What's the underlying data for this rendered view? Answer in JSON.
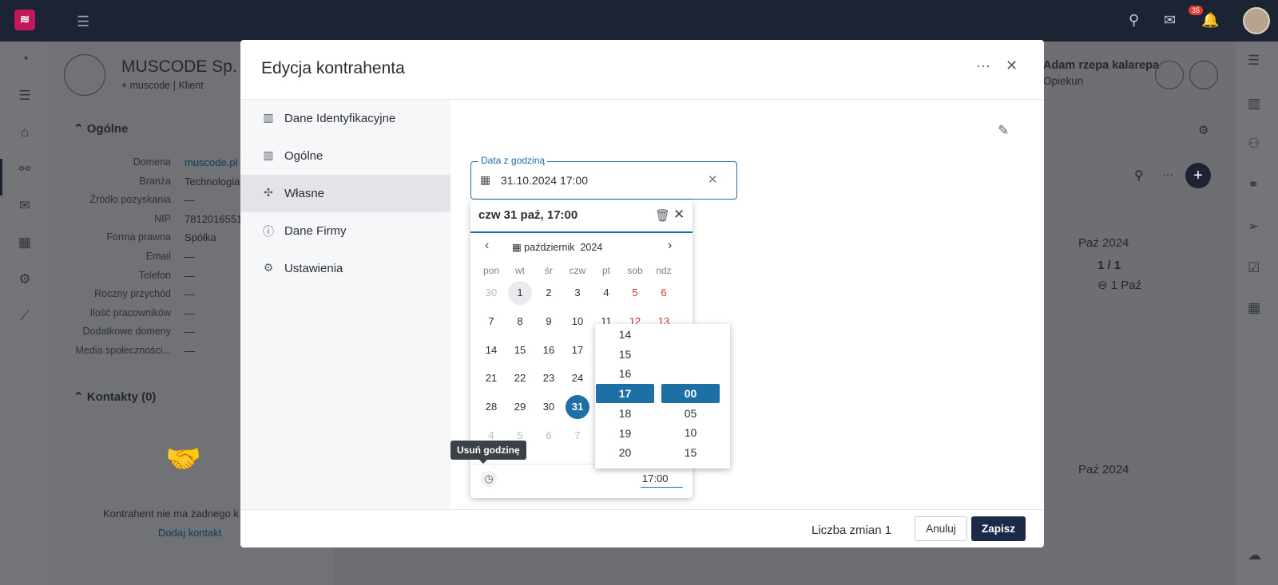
{
  "topbar": {
    "notif_count": "35"
  },
  "background": {
    "company_name": "MUSCODE Sp. z",
    "tag": "muscode",
    "tag_type": "Klient",
    "section_general": "Ogólne",
    "fields": [
      {
        "label": "Domena",
        "value": "muscode.pl"
      },
      {
        "label": "Branża",
        "value": "Technologia"
      },
      {
        "label": "Źródło pozyskania",
        "value": "—"
      },
      {
        "label": "NIP",
        "value": "7812016551"
      },
      {
        "label": "Forma prawna",
        "value": "Spółka"
      },
      {
        "label": "Email",
        "value": "—"
      },
      {
        "label": "Telefon",
        "value": "—"
      },
      {
        "label": "Roczny przychód",
        "value": "—"
      },
      {
        "label": "Ilość pracowników",
        "value": "—"
      },
      {
        "label": "Dodatkowe domeny",
        "value": "—"
      },
      {
        "label": "Media społeczności...",
        "value": "—"
      }
    ],
    "section_contacts": "Kontakty (0)",
    "contacts_empty": "Kontrahent nie ma żadnego k",
    "add_contact": "Dodaj kontakt",
    "owner_name": "Adam rzepa kalarepa",
    "owner_role": "Opiekun",
    "timeline_month_1": "Paź 2024",
    "timeline_count": "1 / 1",
    "timeline_item": "1 Paź",
    "timeline_month_2": "Paź 2024"
  },
  "modal": {
    "title": "Edycja kontrahenta",
    "menu": [
      {
        "label": "Dane Identyfikacyjne"
      },
      {
        "label": "Ogólne"
      },
      {
        "label": "Własne"
      },
      {
        "label": "Dane Firmy"
      },
      {
        "label": "Ustawienia"
      }
    ],
    "changes_label": "Liczba zmian 1",
    "cancel_label": "Anuluj",
    "save_label": "Zapisz"
  },
  "datefield": {
    "label": "Data z godziną",
    "value": "31.10.2024 17:00"
  },
  "calendar": {
    "header": "czw 31 paź, 17:00",
    "month": "październik",
    "year": "2024",
    "weekdays": [
      "pon",
      "wt",
      "śr",
      "czw",
      "pt",
      "sob",
      "ndz"
    ],
    "weeks": [
      [
        "30",
        "1",
        "2",
        "3",
        "4",
        "5",
        "6"
      ],
      [
        "7",
        "8",
        "9",
        "10",
        "11",
        "12",
        "13"
      ],
      [
        "14",
        "15",
        "16",
        "17",
        "",
        "",
        ""
      ],
      [
        "21",
        "22",
        "23",
        "24",
        "",
        "",
        ""
      ],
      [
        "28",
        "29",
        "30",
        "31",
        "",
        "",
        ""
      ],
      [
        "4",
        "5",
        "6",
        "7",
        "",
        "",
        ""
      ]
    ],
    "time_value": "17:00",
    "tooltip": "Usuń godzinę"
  },
  "timepicker": {
    "hours": [
      "14",
      "15",
      "16",
      "17",
      "18",
      "19",
      "20"
    ],
    "minutes": [
      "00",
      "05",
      "10",
      "15"
    ],
    "selected_hour": "17",
    "selected_minute": "00"
  },
  "colors": {
    "accent": "#1e6fa3",
    "dark": "#1c2a4a",
    "weekend": "#d32f2f"
  }
}
